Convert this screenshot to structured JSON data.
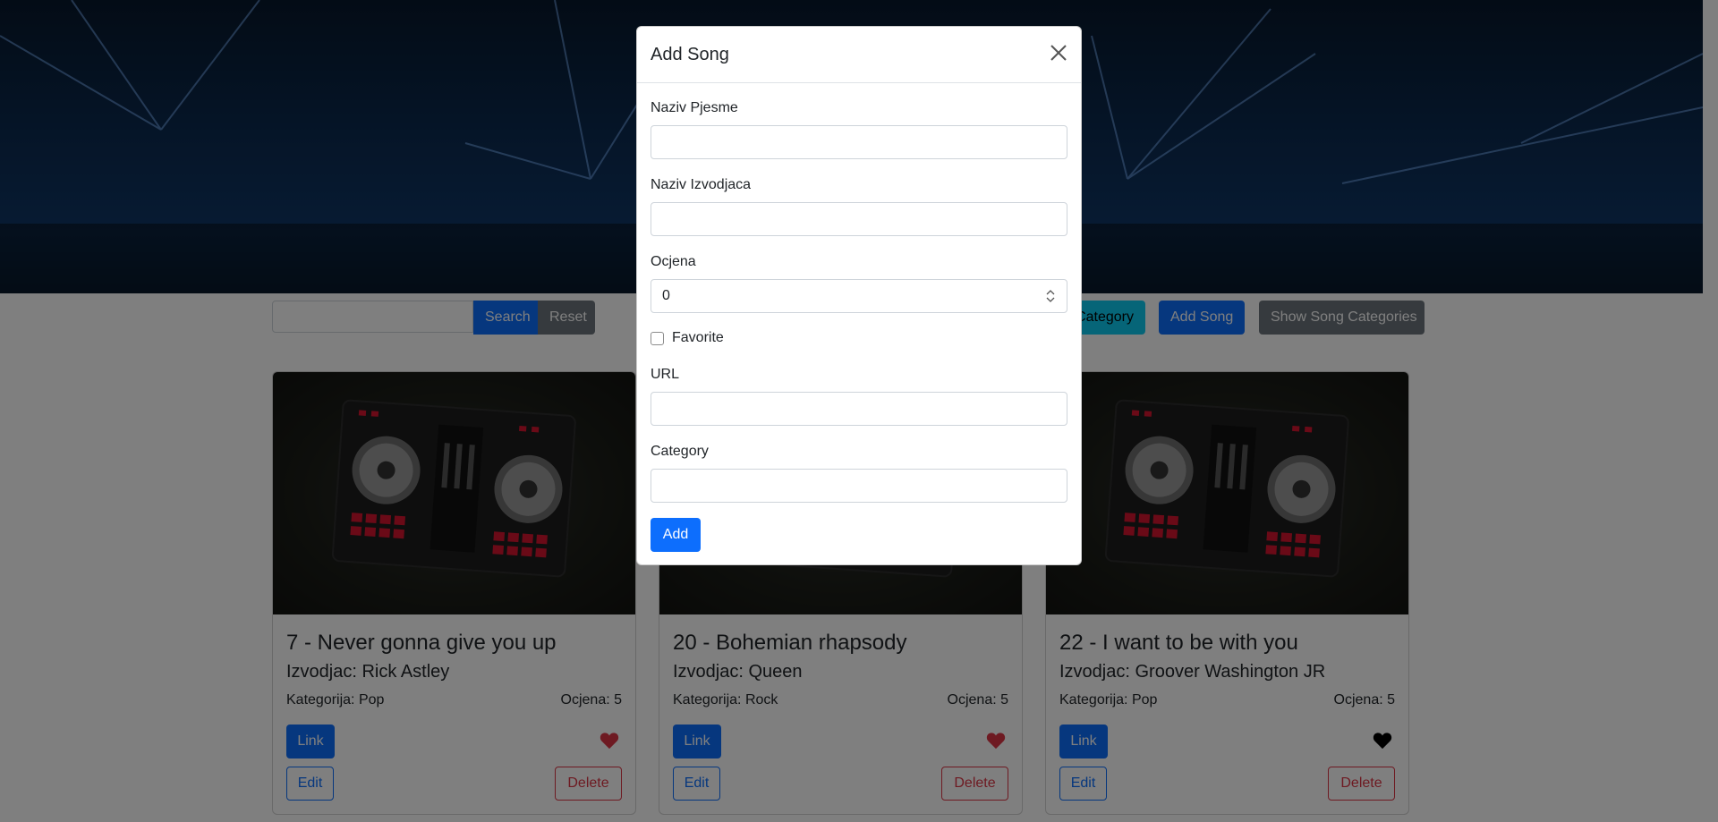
{
  "toolbar": {
    "search_placeholder": "",
    "search_label": "Search",
    "reset_label": "Reset",
    "category_label": "Category",
    "add_song_label": "Add Song",
    "show_categories_label": "Show Song Categories"
  },
  "songs": [
    {
      "title": "7 - Never gonna give you up",
      "artist": "Izvodjac: Rick Astley",
      "category": "Kategorija: Pop",
      "rating": "Ocjena: 5",
      "link_label": "Link",
      "edit_label": "Edit",
      "delete_label": "Delete",
      "favorite": true
    },
    {
      "title": "20 - Bohemian rhapsody",
      "artist": "Izvodjac: Queen",
      "category": "Kategorija: Rock",
      "rating": "Ocjena: 5",
      "link_label": "Link",
      "edit_label": "Edit",
      "delete_label": "Delete",
      "favorite": true
    },
    {
      "title": "22 - I want to be with you",
      "artist": "Izvodjac: Groover Washington JR",
      "category": "Kategorija: Pop",
      "rating": "Ocjena: 5",
      "link_label": "Link",
      "edit_label": "Edit",
      "delete_label": "Delete",
      "favorite": false
    }
  ],
  "modal": {
    "title": "Add Song",
    "song_name_label": "Naziv Pjesme",
    "song_name_value": "",
    "artist_label": "Naziv Izvodjaca",
    "artist_value": "",
    "rating_label": "Ocjena",
    "rating_value": "0",
    "favorite_label": "Favorite",
    "favorite_checked": false,
    "url_label": "URL",
    "url_value": "",
    "category_label": "Category",
    "category_value": "",
    "add_label": "Add"
  },
  "colors": {
    "primary": "#0d6efd",
    "secondary": "#6c757d",
    "info": "#0dcaf0",
    "danger": "#dc3545",
    "heart_favorite": "#dc3545",
    "heart_not_favorite": "#000000"
  }
}
